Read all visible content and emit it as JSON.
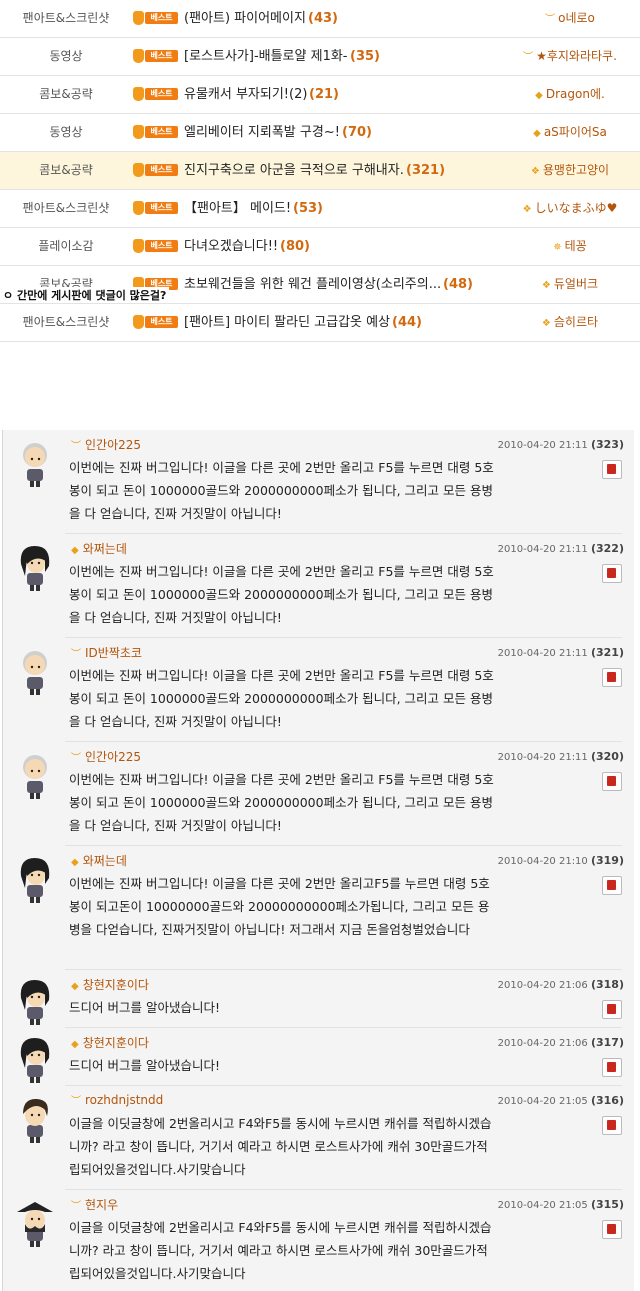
{
  "board": {
    "badge_label": "베스트",
    "rows": [
      {
        "category": "팬아트&스크린샷",
        "title": "(팬아트) 파이어메이지",
        "count": "(43)",
        "author": "o네로o",
        "icon": "wing-icon",
        "highlight": false
      },
      {
        "category": "동영상",
        "title": "[로스트사가]-배틀로얄 제1화-",
        "count": "(35)",
        "author": "★후지와라타쿠.",
        "icon": "wing-icon",
        "highlight": false
      },
      {
        "category": "콤보&공략",
        "title": "유물캐서 부자되기!(2)",
        "count": "(21)",
        "author": "Dragon에.",
        "icon": "diamond-icon",
        "highlight": false
      },
      {
        "category": "동영상",
        "title": "엘리베이터 지뢰폭발 구경~!",
        "count": "(70)",
        "author": "aS파이어Sa",
        "icon": "diamond-icon",
        "highlight": false
      },
      {
        "category": "콤보&공략",
        "title": "진지구축으로 아군을 극적으로 구해내자.",
        "count": "(321)",
        "author": "용맹한고양이",
        "icon": "double-wing-icon",
        "highlight": true
      },
      {
        "category": "팬아트&스크린샷",
        "title": "【팬아트】 메이드!",
        "count": "(53)",
        "author": "しいなまふゆ♥",
        "icon": "double-wing-icon",
        "highlight": false
      },
      {
        "category": "플레이소감",
        "title": "다녀오겠습니다!!",
        "count": "(80)",
        "author": "테꽁",
        "icon": "star-icon",
        "highlight": false
      },
      {
        "category": "콤보&공략",
        "title": "초보웨건들을 위한 웨건 플레이영상(소리주의...",
        "count": "(48)",
        "author": "듀얼버크",
        "icon": "double-wing-icon",
        "highlight": false
      },
      {
        "category": "팬아트&스크린샷",
        "title": "[팬아트] 마이티 팔라딘 고급갑옷 예상",
        "count": "(44)",
        "author": "슴히르타",
        "icon": "double-wing-icon",
        "highlight": false
      }
    ]
  },
  "caption": "ㅇ 간만에 게시판에 댓글이 많은걸?",
  "comments": [
    {
      "name": "인간아225",
      "date": "2010-04-20 21:11",
      "num": "(323)",
      "body": "이번에는 진짜 버그입니다! 이글을 다른 곳에 2번만 올리고 F5를 누르면 대령 5호봉이 되고 돈이 1000000골드와 2000000000페소가 됩니다, 그리고 모든 용병을 다 얻습니다, 진짜 거짓말이 아닙니다!",
      "avatar": "bald",
      "rank": "wing-icon"
    },
    {
      "name": "와쩌는데",
      "date": "2010-04-20 21:11",
      "num": "(322)",
      "body": "이번에는 진짜 버그입니다! 이글을 다른 곳에 2번만 올리고 F5를 누르면 대령 5호봉이 되고 돈이 1000000골드와 2000000000페소가 됩니다, 그리고 모든 용병을 다 얻습니다, 진짜 거짓말이 아닙니다!",
      "avatar": "darkhair",
      "rank": "diamond-icon"
    },
    {
      "name": "ID반짝초코",
      "date": "2010-04-20 21:11",
      "num": "(321)",
      "body": "이번에는 진짜 버그입니다! 이글을 다른 곳에 2번만 올리고 F5를 누르면 대령 5호봉이 되고 돈이 1000000골드와 2000000000페소가 됩니다, 그리고 모든 용병을 다 얻습니다, 진짜 거짓말이 아닙니다!",
      "avatar": "bald",
      "rank": "wing-icon"
    },
    {
      "name": "인간아225",
      "date": "2010-04-20 21:11",
      "num": "(320)",
      "body": "이번에는 진짜 버그입니다! 이글을 다른 곳에 2번만 올리고 F5를 누르면 대령 5호봉이 되고 돈이 1000000골드와 2000000000페소가 됩니다, 그리고 모든 용병을 다 얻습니다, 진짜 거짓말이 아닙니다!",
      "avatar": "bald",
      "rank": "wing-icon"
    },
    {
      "name": "와쩌는데",
      "date": "2010-04-20 21:10",
      "num": "(319)",
      "body": "이번에는 진짜 버그입니다! 이글을 다른 곳에 2번만 올리고F5를 누르면 대령 5호봉이 되고돈이 10000000골드와 20000000000페소가됩니다, 그리고 모든 용병을 다얻습니다, 진짜거짓말이 아닙니다! 저그래서 지금 돈을엄청벌었습니다",
      "avatar": "darkhair",
      "rank": "diamond-icon"
    },
    {
      "name": "창현지훈이다",
      "date": "2010-04-20 21:06",
      "num": "(318)",
      "body": "드디어 버그를 알아냈습니다!",
      "avatar": "darkhair",
      "rank": "diamond-icon"
    },
    {
      "name": "창현지훈이다",
      "date": "2010-04-20 21:06",
      "num": "(317)",
      "body": "드디어 버그를 알아냈습니다!",
      "avatar": "darkhair",
      "rank": "diamond-icon"
    },
    {
      "name": "rozhdnjstndd",
      "date": "2010-04-20 21:05",
      "num": "(316)",
      "body": "이글을 이딧글창에 2번올리시고 F4와F5를 동시에 누르시면 캐쉬를 적립하시겠습니까? 라고 창이 뜹니다, 거기서 예라고 하시면 로스트사가에 캐쉬 30만골드가적립되어있을것입니다.사기맞습니다",
      "avatar": "brownhair",
      "rank": "wing-icon"
    },
    {
      "name": "현지우",
      "date": "2010-04-20 21:05",
      "num": "(315)",
      "body": "이글을 이덧글창에 2번올리시고 F4와F5를 동시에 누르시면 캐쉬를 적립하시겠습니까? 라고 창이 뜹니다, 거기서 예라고 하시면 로스트사가에 캐쉬 30만골드가적립되어있을것입니다.사기맞습니다",
      "avatar": "pirate",
      "rank": "wing-icon"
    }
  ]
}
